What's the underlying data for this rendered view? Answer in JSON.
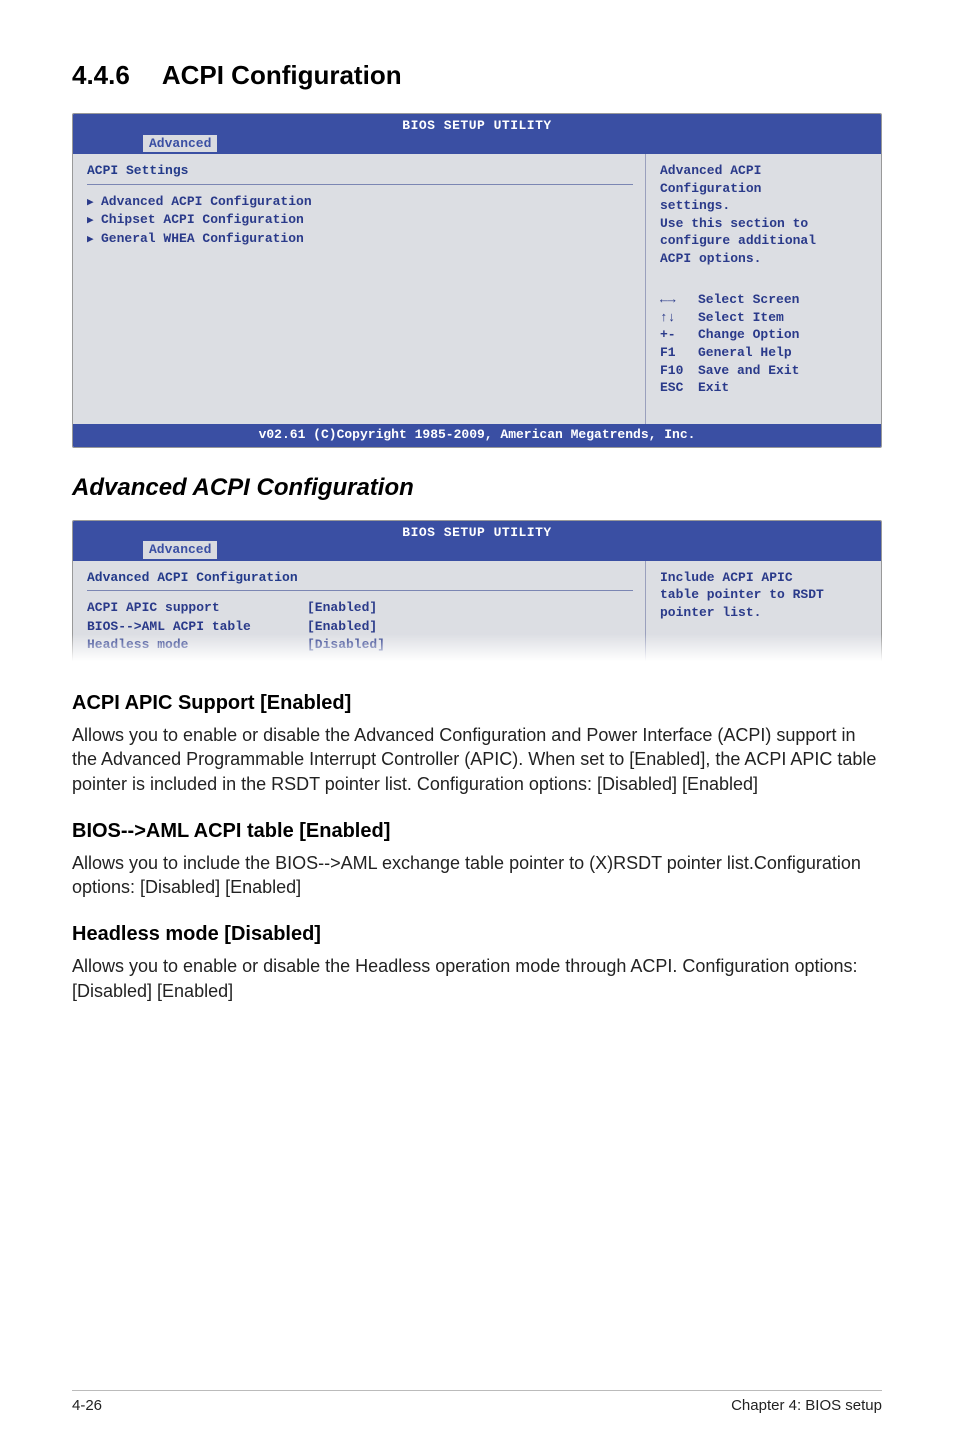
{
  "section": {
    "number": "4.4.6",
    "title": "ACPI Configuration"
  },
  "bios1": {
    "header_title": "BIOS SETUP UTILITY",
    "tab": "Advanced",
    "left": {
      "heading": "ACPI Settings",
      "menu_items": [
        "Advanced ACPI Configuration",
        "Chipset ACPI Configuration",
        "General WHEA Configuration"
      ]
    },
    "right": {
      "help_lines": [
        "Advanced ACPI",
        "Configuration",
        "settings.",
        "",
        "Use this section to",
        "configure additional",
        "ACPI options."
      ],
      "keys": [
        {
          "k": "←→",
          "v": "Select Screen"
        },
        {
          "k": "↑↓",
          "v": "Select Item"
        },
        {
          "k": "+-",
          "v": "Change Option"
        },
        {
          "k": "F1",
          "v": "General Help"
        },
        {
          "k": "F10",
          "v": "Save and Exit"
        },
        {
          "k": "ESC",
          "v": "Exit"
        }
      ]
    },
    "footer": "v02.61 (C)Copyright 1985-2009, American Megatrends, Inc."
  },
  "subheading": "Advanced ACPI Configuration",
  "bios2": {
    "header_title": "BIOS SETUP UTILITY",
    "tab": "Advanced",
    "left": {
      "heading": "Advanced ACPI Configuration",
      "rows": [
        {
          "label": "ACPI APIC support",
          "value": "[Enabled]"
        },
        {
          "label": "BIOS-->AML ACPI table",
          "value": "[Enabled]"
        },
        {
          "label": "Headless mode",
          "value": "[Disabled]"
        }
      ]
    },
    "right": {
      "help_lines": [
        "Include ACPI APIC",
        "table pointer to RSDT",
        "pointer list."
      ]
    }
  },
  "body": {
    "s1_title": "ACPI APIC Support [Enabled]",
    "s1_text": "Allows you to enable or disable the Advanced Configuration and Power Interface (ACPI) support in the Advanced Programmable Interrupt Controller (APIC). When set to [Enabled], the ACPI APIC table pointer is included in the RSDT pointer list. Configuration options: [Disabled] [Enabled]",
    "s2_title": "BIOS-->AML ACPI table [Enabled]",
    "s2_text": "Allows you to include the BIOS-->AML exchange table pointer to (X)RSDT pointer list.Configuration options: [Disabled] [Enabled]",
    "s3_title": "Headless mode [Disabled]",
    "s3_text": "Allows you to enable or disable the Headless operation mode through ACPI. Configuration options: [Disabled] [Enabled]"
  },
  "footer": {
    "left": "4-26",
    "right": "Chapter 4: BIOS setup"
  }
}
